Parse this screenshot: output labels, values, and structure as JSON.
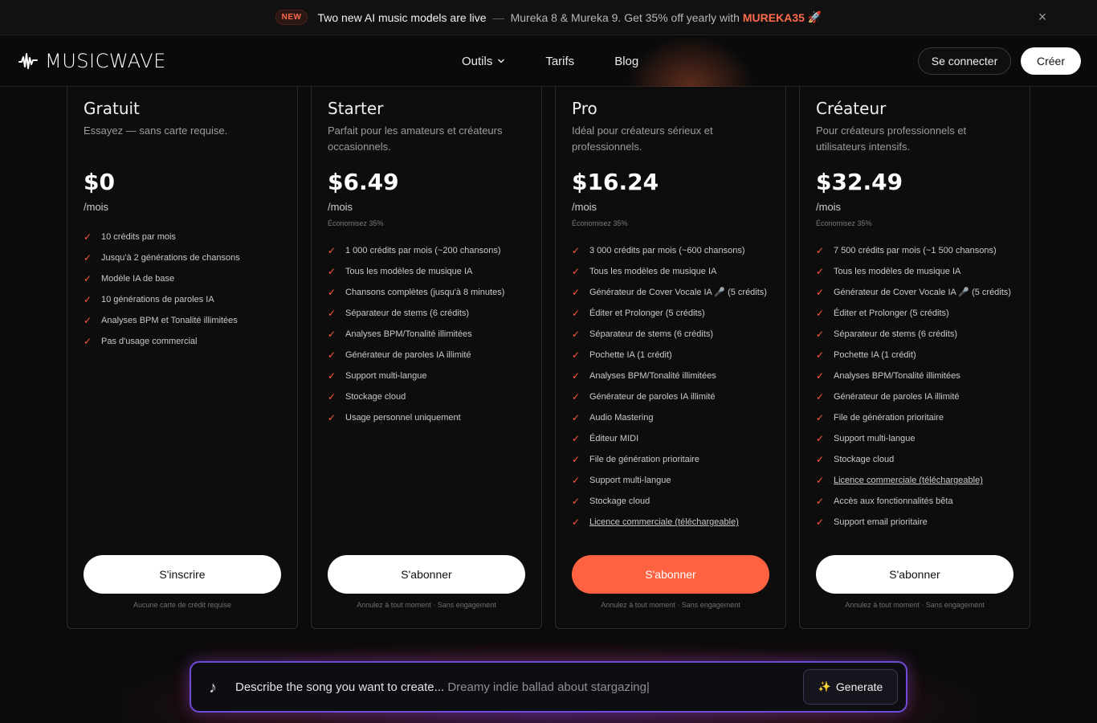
{
  "announcement": {
    "badge": "NEW",
    "headline": "Two new AI music models are live",
    "separator": "—",
    "promo": "Mureka 8 & Mureka 9. Get 35% off yearly with",
    "code": "MUREKA35",
    "rocket": "🚀",
    "close_icon": "×"
  },
  "nav": {
    "logo_text": "MUSICWAVE",
    "menu": [
      {
        "label": "Outils",
        "has_dropdown": true
      },
      {
        "label": "Tarifs"
      },
      {
        "label": "Blog"
      }
    ],
    "chevron": "⌄",
    "login_label": "Se connecter",
    "create_label": "Créer"
  },
  "plans": [
    {
      "name": "Gratuit",
      "description": "Essayez — sans carte requise.",
      "price": "$0",
      "period": "/mois",
      "savings": "",
      "features": [
        {
          "text": "10 crédits par mois"
        },
        {
          "text": "Jusqu'à 2 générations de chansons"
        },
        {
          "text": "Modèle IA de base"
        },
        {
          "text": "10 générations de paroles IA"
        },
        {
          "text": "Analyses BPM et Tonalité illimitées"
        },
        {
          "text": "Pas d'usage commercial"
        }
      ],
      "cta": "S'inscrire",
      "note": "Aucune carte de crédit requise"
    },
    {
      "name": "Starter",
      "description": "Parfait pour les amateurs et créateurs occasionnels.",
      "price": "$6.49",
      "period": "/mois",
      "savings": "Économisez 35%",
      "features": [
        {
          "text": "1 000 crédits par mois (~200 chansons)"
        },
        {
          "text": "Tous les modèles de musique IA"
        },
        {
          "text": "Chansons complètes (jusqu'à 8 minutes)"
        },
        {
          "text": "Séparateur de stems (6 crédits)"
        },
        {
          "text": "Analyses BPM/Tonalité illimitées"
        },
        {
          "text": "Générateur de paroles IA illimité"
        },
        {
          "text": "Support multi-langue"
        },
        {
          "text": "Stockage cloud"
        },
        {
          "text": "Usage personnel uniquement"
        }
      ],
      "cta": "S'abonner",
      "note": "Annulez à tout moment · Sans engagement"
    },
    {
      "name": "Pro",
      "description": "Idéal pour créateurs sérieux et professionnels.",
      "price": "$16.24",
      "period": "/mois",
      "savings": "Économisez 35%",
      "features": [
        {
          "text": "3 000 crédits par mois (~600 chansons)"
        },
        {
          "text": "Tous les modèles de musique IA"
        },
        {
          "text": "Générateur de Cover Vocale IA 🎤 (5 crédits)"
        },
        {
          "text": "Éditer et Prolonger (5 crédits)"
        },
        {
          "text": "Séparateur de stems (6 crédits)"
        },
        {
          "text": "Pochette IA (1 crédit)"
        },
        {
          "text": "Analyses BPM/Tonalité illimitées"
        },
        {
          "text": "Générateur de paroles IA illimité"
        },
        {
          "text": "Audio Mastering"
        },
        {
          "text": "Éditeur MIDI"
        },
        {
          "text": "File de génération prioritaire"
        },
        {
          "text": "Support multi-langue"
        },
        {
          "text": "Stockage cloud"
        },
        {
          "text": "Licence commerciale (téléchargeable)",
          "underline": true
        }
      ],
      "cta": "S'abonner",
      "note": "Annulez à tout moment · Sans engagement",
      "highlight": true
    },
    {
      "name": "Créateur",
      "description": "Pour créateurs professionnels et utilisateurs intensifs.",
      "price": "$32.49",
      "period": "/mois",
      "savings": "Économisez 35%",
      "features": [
        {
          "text": "7 500 crédits par mois (~1 500 chansons)"
        },
        {
          "text": "Tous les modèles de musique IA"
        },
        {
          "text": "Générateur de Cover Vocale IA 🎤 (5 crédits)"
        },
        {
          "text": "Éditer et Prolonger (5 crédits)"
        },
        {
          "text": "Séparateur de stems (6 crédits)"
        },
        {
          "text": "Pochette IA (1 crédit)"
        },
        {
          "text": "Analyses BPM/Tonalité illimitées"
        },
        {
          "text": "Générateur de paroles IA illimité"
        },
        {
          "text": "File de génération prioritaire"
        },
        {
          "text": "Support multi-langue"
        },
        {
          "text": "Stockage cloud"
        },
        {
          "text": "Licence commerciale (téléchargeable)",
          "underline": true
        },
        {
          "text": "Accès aux fonctionnalités bêta"
        },
        {
          "text": "Support email prioritaire"
        }
      ],
      "cta": "S'abonner",
      "note": "Annulez à tout moment · Sans engagement"
    }
  ],
  "check_icon": "✓",
  "prompt_bar": {
    "icon": "music-note-icon",
    "icon_glyph": "♪",
    "lead": "Describe the song you want to create...",
    "example": "Dreamy indie ballad about stargazing|",
    "generate_label": "Generate",
    "generate_icon": "✨"
  },
  "colors": {
    "accent": "#ff6240",
    "background": "#0b0b0c",
    "prompt_border": "#6e4bd8"
  }
}
